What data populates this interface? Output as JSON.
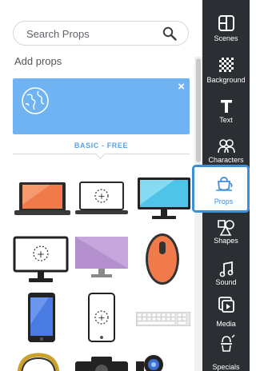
{
  "search": {
    "placeholder": "Search Props"
  },
  "section": {
    "add_label": "Add props"
  },
  "banner": {
    "tier_label": "BASIC - FREE",
    "close_label": "×"
  },
  "props": [
    "laptop",
    "laptop-outline",
    "monitor",
    "monitor-outline",
    "purple-monitor",
    "mouse",
    "phone",
    "phone-outline",
    "keyboard",
    "headphones",
    "camera",
    "webcam"
  ],
  "nav": {
    "scenes": "Scenes",
    "background": "Background",
    "text": "Text",
    "characters": "Characters",
    "props": "Props",
    "shapes": "Shapes",
    "sound": "Sound",
    "media": "Media",
    "specials": "Specials"
  },
  "colors": {
    "accent": "#3f8fd8",
    "banner": "#70b3f2",
    "sidebar": "#2b2f33"
  }
}
